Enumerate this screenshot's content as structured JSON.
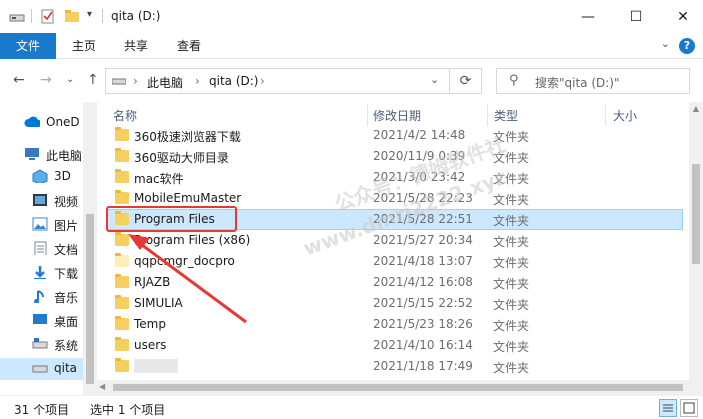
{
  "window": {
    "title": "qita (D:)",
    "minimize": "—",
    "maximize": "☐",
    "close": "✕"
  },
  "ribbon": {
    "tabs": [
      "文件",
      "主页",
      "共享",
      "查看"
    ],
    "help": "?"
  },
  "address": {
    "segments": [
      "此电脑",
      "qita (D:)"
    ],
    "search_placeholder": "搜索\"qita (D:)\""
  },
  "nav": {
    "items": [
      {
        "label": "OneD",
        "icon": "onedrive-icon",
        "color": "#0078d4"
      },
      {
        "label": "此电脑",
        "icon": "this-pc-icon",
        "color": "#3a78b8"
      },
      {
        "label": "3D",
        "icon": "3d-objects-icon",
        "color": "#5ab0e6"
      },
      {
        "label": "视频",
        "icon": "videos-icon",
        "color": "#2f3b47"
      },
      {
        "label": "图片",
        "icon": "pictures-icon",
        "color": "#3d88c7"
      },
      {
        "label": "文档",
        "icon": "documents-icon",
        "color": "#7a8896"
      },
      {
        "label": "下载",
        "icon": "downloads-icon",
        "color": "#1f7ad1"
      },
      {
        "label": "音乐",
        "icon": "music-icon",
        "color": "#1f7ad1"
      },
      {
        "label": "桌面",
        "icon": "desktop-icon",
        "color": "#1f7ad1"
      },
      {
        "label": "系统",
        "icon": "system-drive-icon",
        "color": "#555"
      },
      {
        "label": "qita",
        "icon": "drive-icon",
        "color": "#555"
      }
    ]
  },
  "columns": {
    "name": "名称",
    "date": "修改日期",
    "type": "类型",
    "size": "大小"
  },
  "files": [
    {
      "name": "360极速浏览器下载",
      "date": "2021/4/2 14:48",
      "type": "文件夹"
    },
    {
      "name": "360驱动大师目录",
      "date": "2020/11/9 0:39",
      "type": "文件夹"
    },
    {
      "name": "mac软件",
      "date": "2021/3/0 23:42",
      "type": "文件夹"
    },
    {
      "name": "MobileEmuMaster",
      "date": "2021/5/28 22:23",
      "type": "文件夹"
    },
    {
      "name": "Program Files",
      "date": "2021/5/28 22:51",
      "type": "文件夹"
    },
    {
      "name": "Program Files (x86)",
      "date": "2021/5/27 20:34",
      "type": "文件夹"
    },
    {
      "name": "qqpcmgr_docpro",
      "date": "2021/4/18 13:07",
      "type": "文件夹"
    },
    {
      "name": "RJAZB",
      "date": "2021/4/12 16:08",
      "type": "文件夹"
    },
    {
      "name": "SIMULIA",
      "date": "2021/5/15 22:52",
      "type": "文件夹"
    },
    {
      "name": "Temp",
      "date": "2021/5/23 18:26",
      "type": "文件夹"
    },
    {
      "name": "users",
      "date": "2021/4/10 16:14",
      "type": "文件夹"
    },
    {
      "name": "",
      "date": "2021/1/18 17:49",
      "type": "文件夹"
    }
  ],
  "selected_index": 4,
  "status": {
    "count": "31 个项目",
    "selection": "选中 1 个项目"
  },
  "watermark": {
    "line1": "公众号：德姆软件社",
    "line2": "www.dmrj2222.xyz"
  }
}
